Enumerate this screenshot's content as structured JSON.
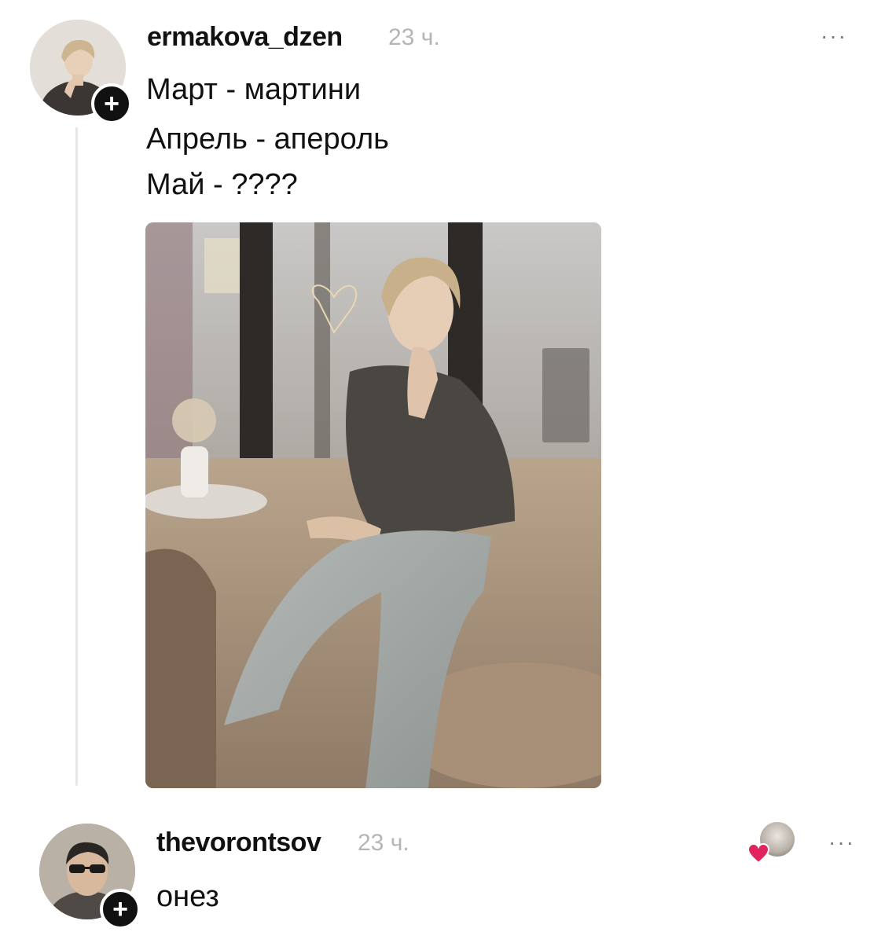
{
  "post": {
    "username": "ermakova_dzen",
    "time": "23 ч.",
    "more_label": "···",
    "lines": [
      "Март - мартини",
      "Апрель - апероль",
      "Май - ????"
    ],
    "follow_badge": "+"
  },
  "reply": {
    "username": "thevorontsov",
    "time": "23 ч.",
    "more_label": "···",
    "text": "онез",
    "follow_badge": "+"
  },
  "colors": {
    "text": "#111111",
    "muted": "#b5b5b5",
    "thread_line": "#e6e6e6",
    "like_heart": "#e0245e"
  },
  "icons": {
    "more": "more-horizontal-icon",
    "follow": "plus-icon",
    "like": "heart-icon"
  }
}
